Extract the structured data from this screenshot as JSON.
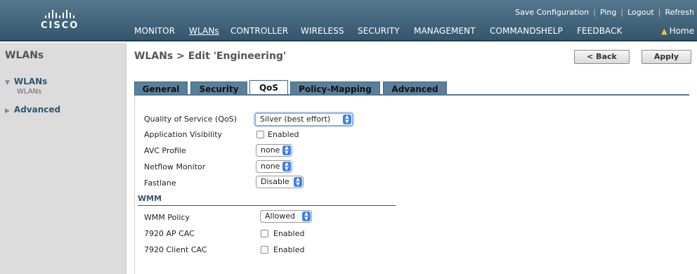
{
  "brand": {
    "logo_text": "CISCO"
  },
  "top_links": [
    "Save Configuration",
    "Ping",
    "Logout",
    "Refresh"
  ],
  "nav": [
    "MONITOR",
    "WLANs",
    "CONTROLLER",
    "WIRELESS",
    "SECURITY",
    "MANAGEMENT",
    "COMMANDS",
    "HELP",
    "FEEDBACK"
  ],
  "nav_active": "WLANs",
  "home_label": "Home",
  "sidebar": {
    "title": "WLANs",
    "items": [
      {
        "label": "WLANs",
        "expanded": true,
        "sub": "WLANs"
      },
      {
        "label": "Advanced",
        "expanded": false
      }
    ]
  },
  "page": {
    "title": "WLANs > Edit  'Engineering'",
    "back_label": "< Back",
    "apply_label": "Apply"
  },
  "tabs": [
    "General",
    "Security",
    "QoS",
    "Policy-Mapping",
    "Advanced"
  ],
  "active_tab": "QoS",
  "form": {
    "qos_label": "Quality of Service (QoS)",
    "qos_value": "Silver (best effort)",
    "app_vis_label": "Application Visibility",
    "app_vis_check": "Enabled",
    "avc_label": "AVC Profile",
    "avc_value": "none",
    "netflow_label": "Netflow Monitor",
    "netflow_value": "none",
    "fastlane_label": "Fastlane",
    "fastlane_value": "Disable"
  },
  "wmm": {
    "heading": "WMM",
    "policy_label": "WMM Policy",
    "policy_value": "Allowed",
    "ap_cac_label": "7920 AP CAC",
    "ap_cac_check": "Enabled",
    "client_cac_label": "7920 Client CAC",
    "client_cac_check": "Enabled"
  },
  "colors": {
    "header": "#34556c",
    "tab": "#5a7f99",
    "accent": "#3b82e6"
  }
}
